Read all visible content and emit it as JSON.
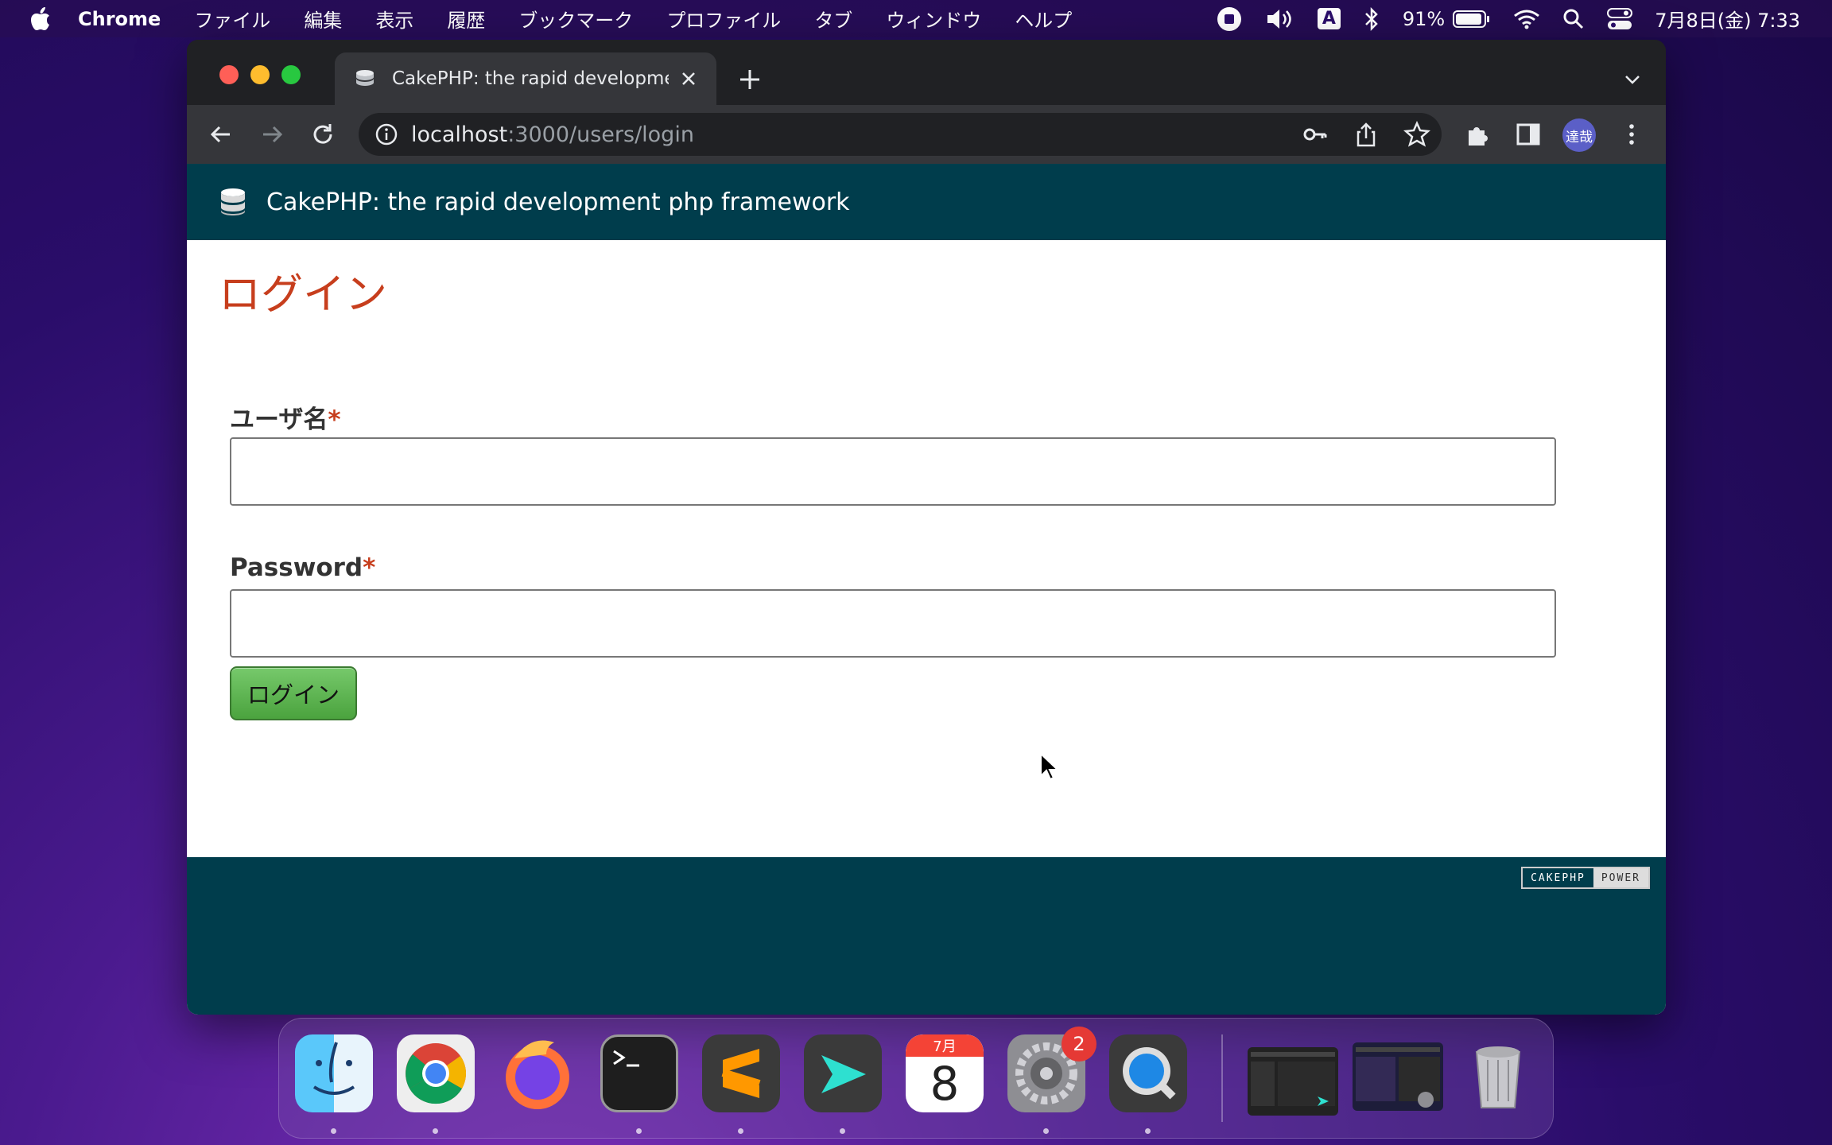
{
  "menubar": {
    "app_name": "Chrome",
    "items": [
      "ファイル",
      "編集",
      "表示",
      "履歴",
      "ブックマーク",
      "プロファイル",
      "タブ",
      "ウィンドウ",
      "ヘルプ"
    ],
    "battery": "91%",
    "input_indicator": "A",
    "datetime": "7月8日(金) 7:33"
  },
  "browser": {
    "tab_title": "CakePHP: the rapid developme",
    "url_host": "localhost",
    "url_path": ":3000/users/login",
    "profile_label": "達哉"
  },
  "site": {
    "header_title": "CakePHP: the rapid development php framework",
    "page_heading": "ログイン",
    "username_label": "ユーザ名",
    "password_label": "Password",
    "required_mark": "*",
    "username_value": "",
    "password_value": "",
    "submit_label": "ログイン",
    "power_badge_left": "CAKEPHP",
    "power_badge_right": "POWER"
  },
  "dock": {
    "apps": [
      "finder",
      "chrome",
      "firefox",
      "terminal",
      "sublime-text",
      "cursor",
      "calendar",
      "system-preferences",
      "quicktime"
    ],
    "calendar_month": "7月",
    "calendar_day": "8",
    "system_preferences_badge": "2"
  },
  "colors": {
    "site_header": "#003d4c",
    "heading": "#c73e1d",
    "button": "#5cb85c"
  }
}
